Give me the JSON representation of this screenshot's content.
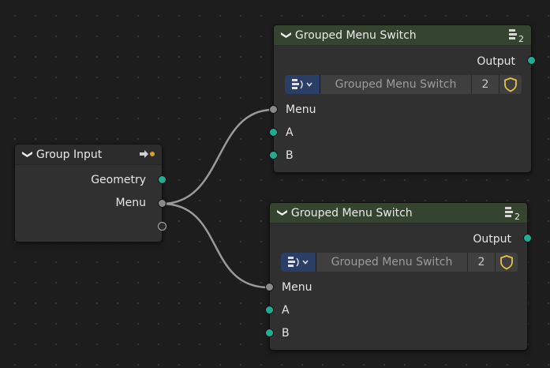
{
  "group_input": {
    "title": "Group Input",
    "outputs": [
      "Geometry",
      "Menu"
    ]
  },
  "switch_nodes": [
    {
      "title": "Grouped Menu Switch",
      "badge": "2",
      "output_label": "Output",
      "menu_name": "Grouped Menu Switch",
      "menu_count": "2",
      "inputs": [
        "Menu",
        "A",
        "B"
      ]
    },
    {
      "title": "Grouped Menu Switch",
      "badge": "2",
      "output_label": "Output",
      "menu_name": "Grouped Menu Switch",
      "menu_count": "2",
      "inputs": [
        "Menu",
        "A",
        "B"
      ]
    }
  ],
  "colors": {
    "canvas": "#1d1d1d",
    "node_body": "#303030",
    "group_header": "#35442f",
    "geometry_socket": "#22ad92",
    "menu_socket": "#8a8a8a",
    "link": "#9a9a9a",
    "menu_widget_icon": "#2a3e66",
    "shield": "#e6c34a"
  },
  "icons": {
    "collapse": "chevron-down-icon",
    "header_node_group": "node-group-icon",
    "group_input_header": "arrow-right-icon",
    "menu_type": "menu-dropdown-icon",
    "fake_user": "shield-icon"
  }
}
